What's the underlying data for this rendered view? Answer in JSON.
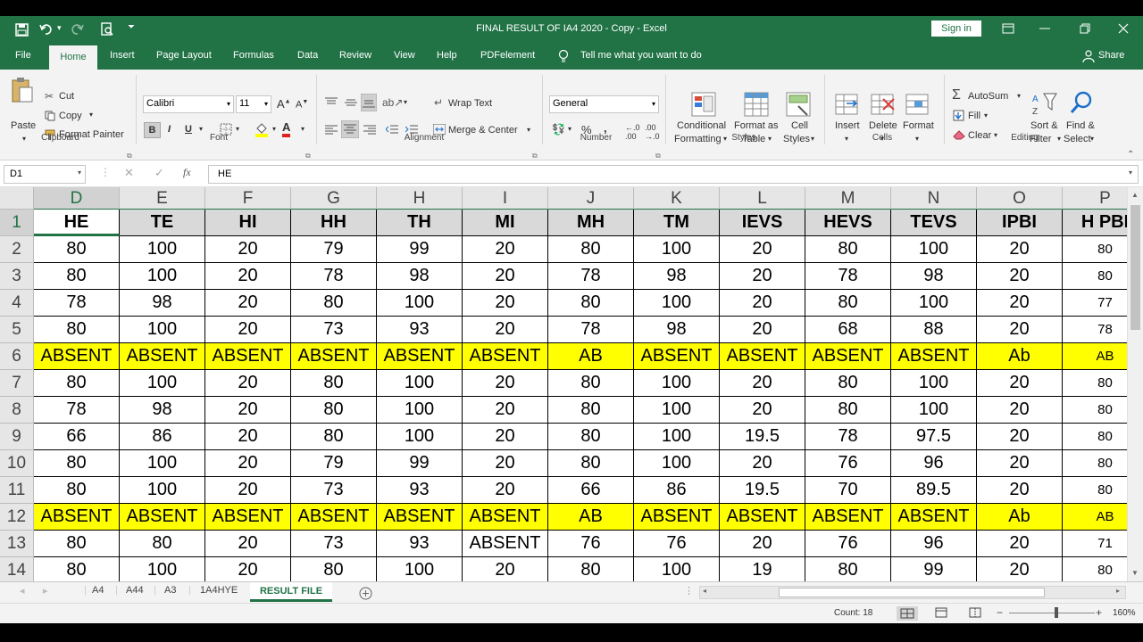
{
  "app": {
    "title": "FINAL RESULT OF IA4 2020 - Copy  -  Excel",
    "sign_in": "Sign in",
    "share": "Share"
  },
  "menu_tabs": [
    "File",
    "Home",
    "Insert",
    "Page Layout",
    "Formulas",
    "Data",
    "Review",
    "View",
    "Help",
    "PDFelement",
    "Tell me what you want to do"
  ],
  "ribbon": {
    "clipboard": {
      "paste": "Paste",
      "cut": "Cut",
      "copy": "Copy",
      "format_painter": "Format Painter",
      "group": "Clipboard"
    },
    "font": {
      "name": "Calibri",
      "size": "11",
      "bold": "B",
      "italic": "I",
      "underline": "U",
      "group": "Font"
    },
    "alignment": {
      "wrap_text": "Wrap Text",
      "merge_center": "Merge & Center",
      "group": "Alignment"
    },
    "number": {
      "format": "General",
      "group": "Number"
    },
    "styles": {
      "conditional": "Conditional",
      "formatting": "Formatting",
      "format_as": "Format as",
      "table": "Table",
      "cell": "Cell",
      "styles_label": "Styles",
      "group": "Styles"
    },
    "cells": {
      "insert": "Insert",
      "delete": "Delete",
      "format": "Format",
      "group": "Cells"
    },
    "editing": {
      "autosum": "AutoSum",
      "fill": "Fill",
      "clear": "Clear",
      "sort": "Sort &",
      "filter": "Filter",
      "find": "Find &",
      "select": "Select",
      "group": "Editing"
    }
  },
  "formula_bar": {
    "name_box": "D1",
    "fx": "fx",
    "content": "HE"
  },
  "columns": [
    "D",
    "E",
    "F",
    "G",
    "H",
    "I",
    "J",
    "K",
    "L",
    "M",
    "N",
    "O",
    "P"
  ],
  "rows": [
    {
      "num": "1",
      "type": "header",
      "cells": [
        "HE",
        "TE",
        "HI",
        "HH",
        "TH",
        "MI",
        "MH",
        "TM",
        "IEVS",
        "HEVS",
        "TEVS",
        "IPBI",
        "H PBI"
      ]
    },
    {
      "num": "2",
      "type": "data",
      "cells": [
        "80",
        "100",
        "20",
        "79",
        "99",
        "20",
        "80",
        "100",
        "20",
        "80",
        "100",
        "20",
        "80"
      ]
    },
    {
      "num": "3",
      "type": "data",
      "cells": [
        "80",
        "100",
        "20",
        "78",
        "98",
        "20",
        "78",
        "98",
        "20",
        "78",
        "98",
        "20",
        "80"
      ]
    },
    {
      "num": "4",
      "type": "data",
      "cells": [
        "78",
        "98",
        "20",
        "80",
        "100",
        "20",
        "80",
        "100",
        "20",
        "80",
        "100",
        "20",
        "77"
      ]
    },
    {
      "num": "5",
      "type": "data",
      "cells": [
        "80",
        "100",
        "20",
        "73",
        "93",
        "20",
        "78",
        "98",
        "20",
        "68",
        "88",
        "20",
        "78"
      ]
    },
    {
      "num": "6",
      "type": "absent",
      "cells": [
        "ABSENT",
        "ABSENT",
        "ABSENT",
        "ABSENT",
        "ABSENT",
        "ABSENT",
        "AB",
        "ABSENT",
        "ABSENT",
        "ABSENT",
        "ABSENT",
        "Ab",
        "AB"
      ]
    },
    {
      "num": "7",
      "type": "data",
      "cells": [
        "80",
        "100",
        "20",
        "80",
        "100",
        "20",
        "80",
        "100",
        "20",
        "80",
        "100",
        "20",
        "80"
      ]
    },
    {
      "num": "8",
      "type": "data",
      "cells": [
        "78",
        "98",
        "20",
        "80",
        "100",
        "20",
        "80",
        "100",
        "20",
        "80",
        "100",
        "20",
        "80"
      ]
    },
    {
      "num": "9",
      "type": "data",
      "cells": [
        "66",
        "86",
        "20",
        "80",
        "100",
        "20",
        "80",
        "100",
        "19.5",
        "78",
        "97.5",
        "20",
        "80"
      ]
    },
    {
      "num": "10",
      "type": "data",
      "cells": [
        "80",
        "100",
        "20",
        "79",
        "99",
        "20",
        "80",
        "100",
        "20",
        "76",
        "96",
        "20",
        "80"
      ]
    },
    {
      "num": "11",
      "type": "data",
      "cells": [
        "80",
        "100",
        "20",
        "73",
        "93",
        "20",
        "66",
        "86",
        "19.5",
        "70",
        "89.5",
        "20",
        "80"
      ]
    },
    {
      "num": "12",
      "type": "absent",
      "cells": [
        "ABSENT",
        "ABSENT",
        "ABSENT",
        "ABSENT",
        "ABSENT",
        "ABSENT",
        "AB",
        "ABSENT",
        "ABSENT",
        "ABSENT",
        "ABSENT",
        "Ab",
        "AB"
      ]
    },
    {
      "num": "13",
      "type": "data",
      "cells": [
        "80",
        "80",
        "20",
        "73",
        "93",
        "ABSENT",
        "76",
        "76",
        "20",
        "76",
        "96",
        "20",
        "71"
      ]
    },
    {
      "num": "14",
      "type": "data",
      "cells": [
        "80",
        "100",
        "20",
        "80",
        "100",
        "20",
        "80",
        "100",
        "19",
        "80",
        "99",
        "20",
        "80"
      ]
    }
  ],
  "sheets": [
    "A4",
    "A44",
    "A3",
    "1A4HYE",
    "RESULT FILE"
  ],
  "status": {
    "count": "Count: 18",
    "zoom": "160%"
  },
  "colors": {
    "accent": "#217346",
    "absent_fill": "#ffff00",
    "header_fill": "#d9d9d9"
  }
}
